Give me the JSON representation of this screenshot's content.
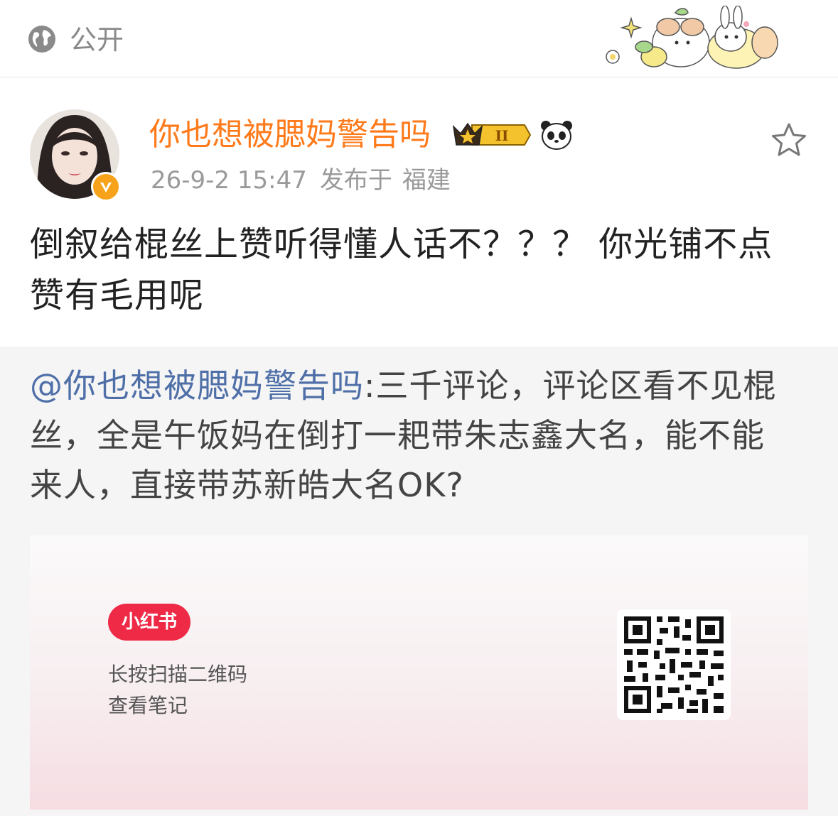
{
  "header": {
    "visibility_icon": "globe-icon",
    "visibility_label": "公开",
    "decoration": "sticker-illustration"
  },
  "post": {
    "username": "你也想被腮妈警告吗",
    "avatar": "avatar-photo",
    "verified_icon": "verified-v-icon",
    "rank_badge_label": "II",
    "badge_icons": [
      "crown-rank-badge-icon",
      "panda-icon"
    ],
    "timestamp": "26-9-2 15:47",
    "location_prefix": "发布于",
    "location": "福建",
    "favorite_icon": "star-icon",
    "text_line1": "倒叙给棍丝上赞听得懂人话不？？？ 你光铺不点",
    "text_line2": "赞有毛用呢",
    "username_color": "#ff7a1a"
  },
  "repost": {
    "mention": "@你也想被腮妈警告吗",
    "text_line1_rest": ":三千评论，评论区看不见棍",
    "text_line2": "丝，全是午饭妈在倒打一耙带朱志鑫大名，能不能",
    "text_line3": "来人，直接带苏新皓大名OK?",
    "mention_color": "#4f6fa8"
  },
  "card": {
    "logo_text": "小红书",
    "instruction_line1": "长按扫描二维码",
    "instruction_line2": "查看笔记",
    "logo_color": "#ee2a47"
  }
}
